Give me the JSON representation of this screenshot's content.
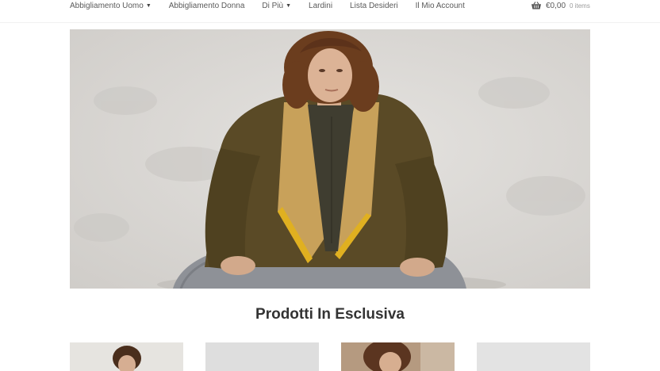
{
  "nav": {
    "items": [
      {
        "label": "Abbigliamento Uomo",
        "has_dropdown": true
      },
      {
        "label": "Abbigliamento Donna",
        "has_dropdown": false
      },
      {
        "label": "Di Più",
        "has_dropdown": true
      },
      {
        "label": "Lardini",
        "has_dropdown": false
      },
      {
        "label": "Lista Desideri",
        "has_dropdown": false
      },
      {
        "label": "Il Mio Account",
        "has_dropdown": false
      }
    ],
    "cart": {
      "icon": "basket-icon",
      "total": "€0,00",
      "count": "0 items"
    }
  },
  "hero": {
    "image": "man-in-olive-jacket-yellow-scarf-photo",
    "colors": {
      "wall": "#dcdad7",
      "jacket": "#5a4a26",
      "scarf": "#c8a15a",
      "trim": "#e0b020",
      "trousers": "#8e9197"
    }
  },
  "section": {
    "title": "Prodotti In Esclusiva"
  },
  "products": [
    {
      "image": "product-photo-model-dark-hair"
    },
    {
      "image": "product-photo-light-grey"
    },
    {
      "image": "product-photo-model-curly-hair"
    },
    {
      "image": "product-photo-light-grey"
    }
  ]
}
